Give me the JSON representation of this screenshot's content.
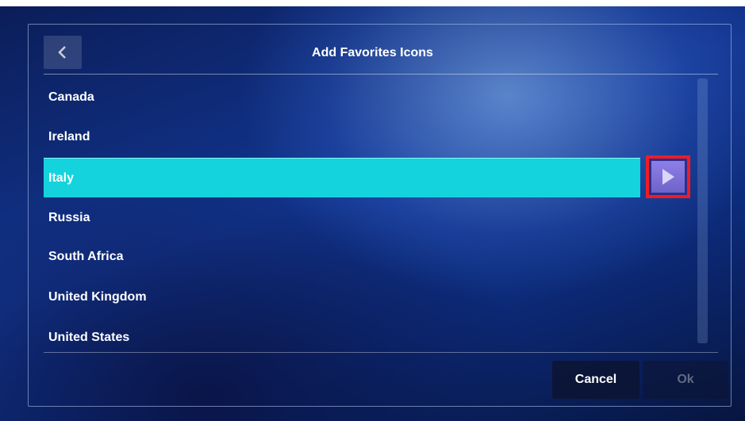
{
  "header": {
    "back_icon": "chevron-left-icon",
    "title": "Add Favorites Icons"
  },
  "list": {
    "items": [
      {
        "label": "Canada",
        "selected": false
      },
      {
        "label": "Ireland",
        "selected": false
      },
      {
        "label": "Italy",
        "selected": true
      },
      {
        "label": "Russia",
        "selected": false
      },
      {
        "label": "South Africa",
        "selected": false
      },
      {
        "label": "United Kingdom",
        "selected": false
      },
      {
        "label": "United States",
        "selected": false
      }
    ],
    "detail_icon": "play-arrow-icon"
  },
  "footer": {
    "cancel_label": "Cancel",
    "ok_label": "Ok"
  },
  "colors": {
    "selection": "#14d3dc",
    "highlight_border": "#ee1c25",
    "arrow_button": "#7e72dc"
  }
}
